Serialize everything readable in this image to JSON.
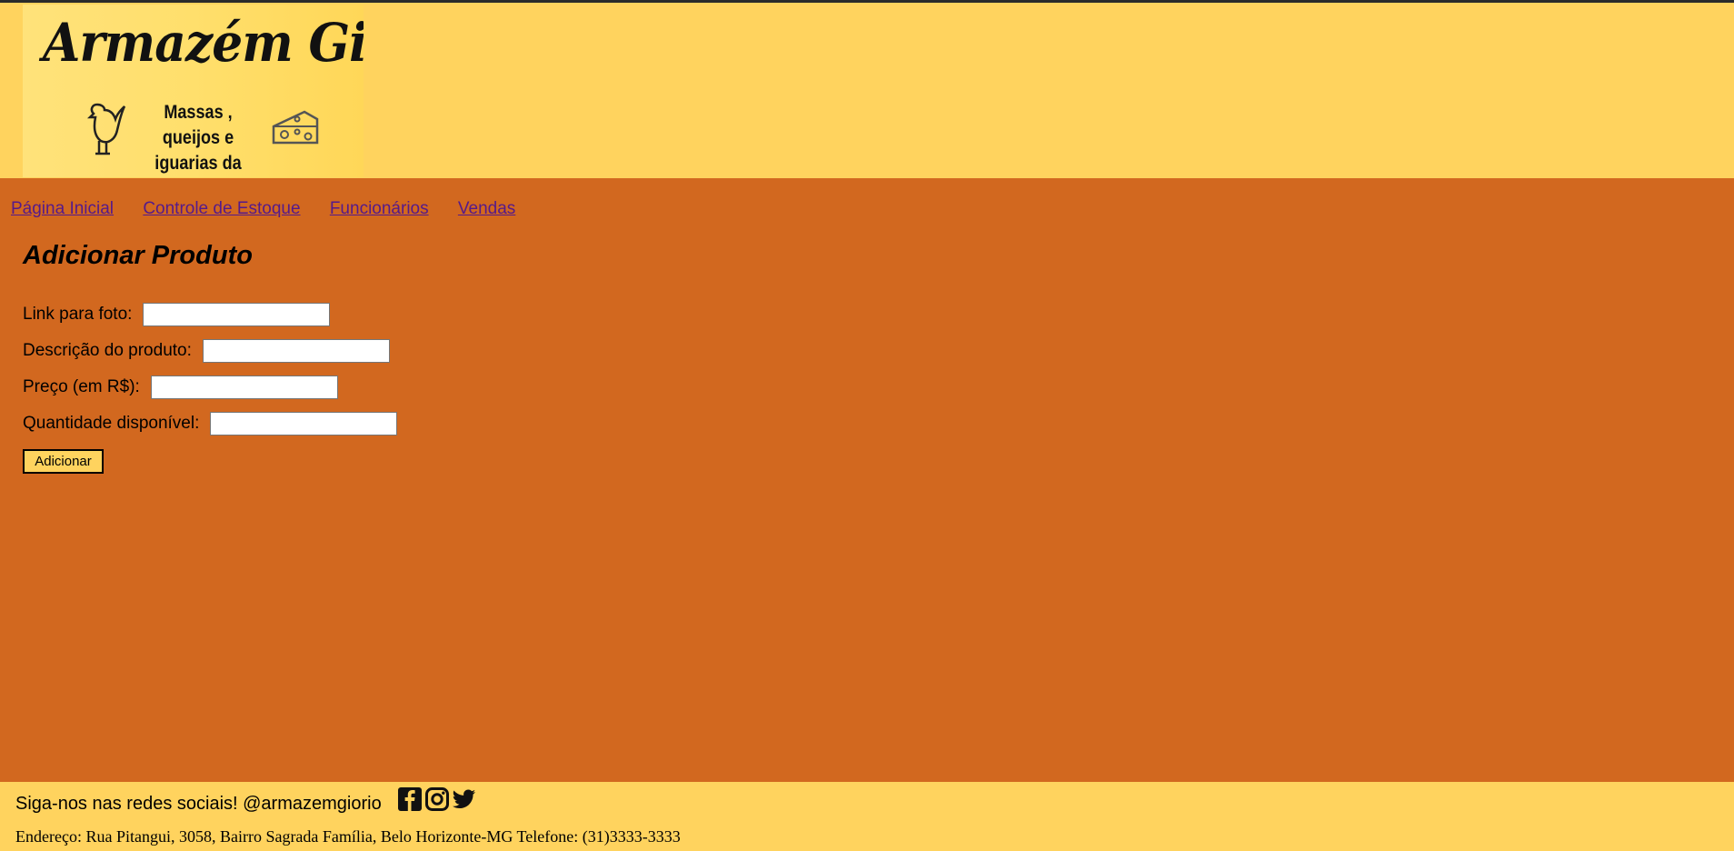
{
  "header": {
    "logo": {
      "title": "Armazém Giório",
      "subtitle_line1": "Massas , queijos e",
      "subtitle_line2": "iguarias da roça"
    }
  },
  "nav": {
    "items": [
      {
        "label": "Página Inicial"
      },
      {
        "label": "Controle de Estoque"
      },
      {
        "label": "Funcionários"
      },
      {
        "label": "Vendas"
      }
    ]
  },
  "main": {
    "title": "Adicionar Produto",
    "fields": [
      {
        "label": "Link para foto:",
        "value": ""
      },
      {
        "label": "Descrição do produto:",
        "value": ""
      },
      {
        "label": "Preço (em R$):",
        "value": ""
      },
      {
        "label": "Quantidade disponível:",
        "value": ""
      }
    ],
    "submit_label": "Adicionar"
  },
  "footer": {
    "follow_text": "Siga-nos nas redes sociais! @armazemgiorio",
    "social_icons": [
      "facebook-icon",
      "instagram-icon",
      "twitter-icon"
    ],
    "address": "Endereço: Rua Pitangui, 3058, Bairro Sagrada Família, Belo Horizonte-MG Telefone: (31)3333-3333"
  },
  "colors": {
    "header_bg": "#ffd35e",
    "body_bg": "#d2681f",
    "link": "#551a8b",
    "text": "#000000"
  }
}
